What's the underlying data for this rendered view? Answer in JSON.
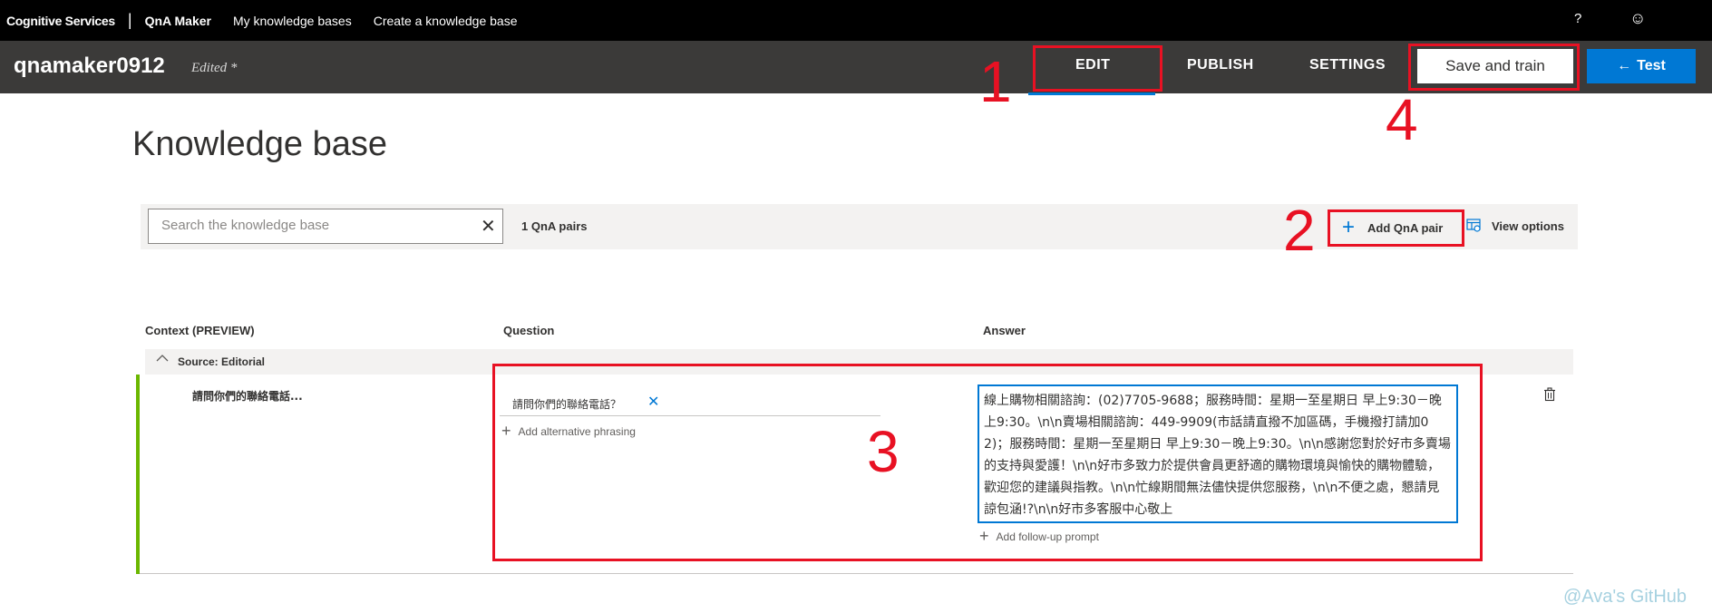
{
  "topnav": {
    "brand": "Cognitive Services",
    "separator": "|",
    "product": "QnA Maker",
    "links": [
      "My knowledge bases",
      "Create a knowledge base"
    ],
    "help": "?",
    "feedback": "☺"
  },
  "kb": {
    "name": "qnamaker0912",
    "status": "Edited *"
  },
  "tabs": {
    "edit": "EDIT",
    "publish": "PUBLISH",
    "settings": "SETTINGS"
  },
  "actions": {
    "save_train": "Save and train",
    "test": "Test",
    "test_icon": "←"
  },
  "page": {
    "title": "Knowledge base"
  },
  "toolbar": {
    "search_placeholder": "Search the knowledge base",
    "clear_icon": "✕",
    "pair_count": "1 QnA pairs",
    "add_pair": "Add QnA pair",
    "view_options": "View options"
  },
  "table": {
    "headers": {
      "context": "Context (PREVIEW)",
      "question": "Question",
      "answer": "Answer"
    },
    "source_label": "Source: Editorial",
    "rows": [
      {
        "context": "請問你們的聯絡電話...",
        "question": "請問你們的聯絡電話？",
        "add_alternative": "Add alternative phrasing",
        "answer": "線上購物相關諮詢：(02)7705-9688；服務時間：星期一至星期日 早上9:30－晚上9:30。\\n\\n賣場相關諮詢：449-9909(市話請直撥不加區碼，手機撥打請加02)；服務時間：星期一至星期日 早上9:30－晚上9:30。\\n\\n感謝您對於好市多賣場的支持與愛護！\\n\\n好市多致力於提供會員更舒適的購物環境與愉快的購物體驗，歡迎您的建議與指教。\\n\\n忙線期間無法儘快提供您服務，\\n\\n不便之處，懇請見諒包涵!?\\n\\n好市多客服中心敬上",
        "add_followup": "Add follow-up prompt"
      }
    ]
  },
  "annotations": {
    "n1": "1",
    "n2": "2",
    "n3": "3",
    "n4": "4",
    "color": "#e81123"
  },
  "watermark": "@Ava's GitHub",
  "colors": {
    "accent": "#0078d4",
    "row_accent": "#6bb700",
    "header_bg": "#3b3a39"
  }
}
